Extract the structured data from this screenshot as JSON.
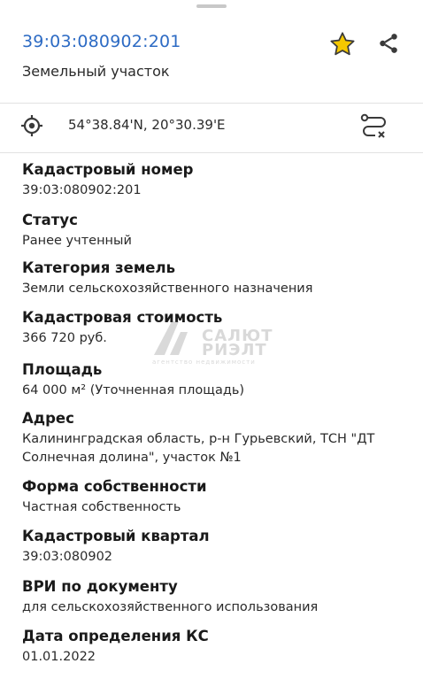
{
  "header": {
    "parcel_id": "39:03:080902:201",
    "parcel_type": "Земельный участок",
    "star_color": "#f2c300",
    "star_icon": "star-icon",
    "share_icon": "share-icon"
  },
  "location": {
    "coordinates": "54°38.84'N, 20°30.39'E",
    "target_icon": "gps-target-icon",
    "route_icon": "route-icon"
  },
  "fields": [
    {
      "label": "Кадастровый номер",
      "value": "39:03:080902:201"
    },
    {
      "label": "Статус",
      "value": "Ранее учтенный"
    },
    {
      "label": "Категория земель",
      "value": "Земли сельскохозяйственного назначения"
    },
    {
      "label": "Кадастровая стоимость",
      "value": "366 720 руб."
    },
    {
      "label": "Площадь",
      "value": "64 000 м² (Уточненная площадь)"
    },
    {
      "label": "Адрес",
      "value_line1": "Калининградская область, р-н Гурьевский, ТСН \"ДТ",
      "value_line2": "Солнечная долина\", участок №1"
    },
    {
      "label": "Форма собственности",
      "value": "Частная собственность"
    },
    {
      "label": "Кадастровый квартал",
      "value": "39:03:080902"
    },
    {
      "label": "ВРИ по документу",
      "value": "для сельскохозяйственного использования"
    },
    {
      "label": "Дата определения КС",
      "value": "01.01.2022"
    }
  ],
  "watermark": {
    "line1": "САЛЮТ",
    "line2": "РИЭЛТ",
    "line3": "агентство недвижимости"
  }
}
